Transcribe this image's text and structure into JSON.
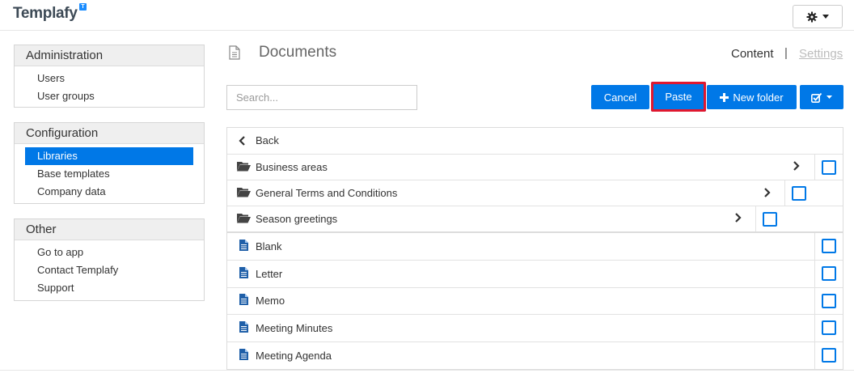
{
  "app": {
    "logo_text": "Templafy",
    "logo_badge": "T"
  },
  "header": {
    "settings_icon": "gear-icon",
    "dropdown_icon": "caret-down-icon"
  },
  "sidebar": {
    "sections": [
      {
        "title": "Administration",
        "items": [
          {
            "label": "Users"
          },
          {
            "label": "User groups"
          }
        ]
      },
      {
        "title": "Configuration",
        "items": [
          {
            "label": "Libraries",
            "active": true
          },
          {
            "label": "Base templates"
          },
          {
            "label": "Company data"
          }
        ]
      },
      {
        "title": "Other",
        "items": [
          {
            "label": "Go to app"
          },
          {
            "label": "Contact Templafy"
          },
          {
            "label": "Support"
          }
        ]
      }
    ]
  },
  "main": {
    "title": "Documents",
    "tabs": {
      "content": "Content",
      "separator": "|",
      "settings": "Settings"
    },
    "search": {
      "placeholder": "Search...",
      "value": ""
    },
    "buttons": {
      "cancel": "Cancel",
      "paste": "Paste",
      "new_folder": "New folder"
    },
    "back_label": "Back",
    "folders": [
      {
        "label": "Business areas"
      },
      {
        "label": "General Terms and Conditions"
      },
      {
        "label": "Season greetings"
      }
    ],
    "documents": [
      {
        "label": "Blank"
      },
      {
        "label": "Letter"
      },
      {
        "label": "Memo"
      },
      {
        "label": "Meeting Minutes"
      },
      {
        "label": "Meeting Agenda"
      }
    ]
  },
  "colors": {
    "accent": "#0078e7",
    "highlight": "#e0182f"
  }
}
